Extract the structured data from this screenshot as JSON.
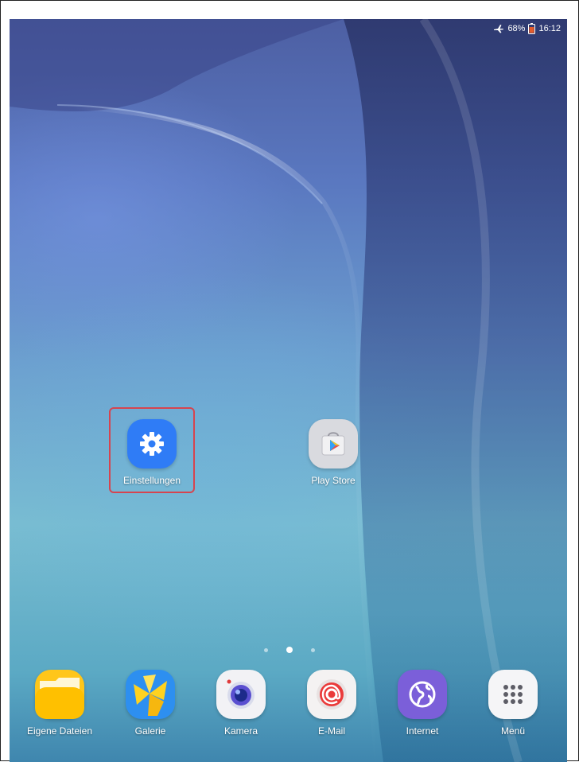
{
  "status_bar": {
    "icons": [
      "airplane-mode-icon",
      "battery-icon"
    ],
    "battery": "68%",
    "time": "16:12"
  },
  "home": {
    "apps": [
      {
        "label": "Einstellungen",
        "icon": "gear-icon",
        "color": "#2f7cf6",
        "highlighted": true
      },
      {
        "label": "Play Store",
        "icon": "play-store-icon",
        "color": "#d9dadf",
        "highlighted": false
      }
    ],
    "page_indicator": {
      "pages": 3,
      "current": 2
    }
  },
  "dock": {
    "apps": [
      {
        "label": "Eigene Dateien",
        "icon": "folder-icon",
        "color": "#ffc61a"
      },
      {
        "label": "Galerie",
        "icon": "gallery-icon",
        "color": "#2d8ff0"
      },
      {
        "label": "Kamera",
        "icon": "camera-icon",
        "color": "#f2f2f5"
      },
      {
        "label": "E-Mail",
        "icon": "email-icon",
        "color": "#f4f2f2"
      },
      {
        "label": "Internet",
        "icon": "internet-icon",
        "color": "#7b5fd9"
      },
      {
        "label": "Menü",
        "icon": "apps-grid-icon",
        "color": "#f5f5f7"
      }
    ]
  },
  "colors": {
    "highlight_border": "#d6444f"
  }
}
